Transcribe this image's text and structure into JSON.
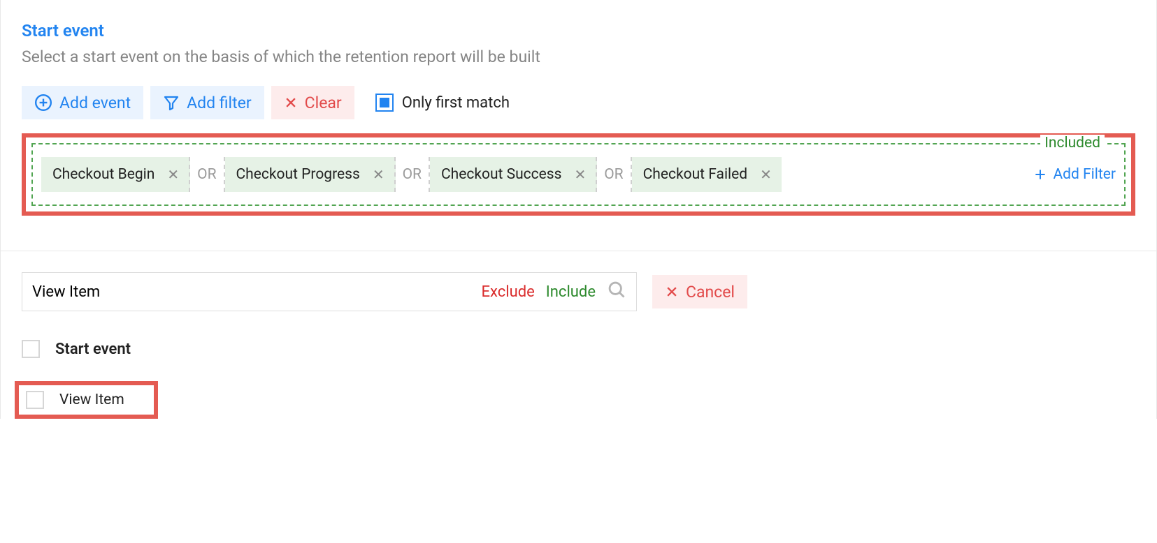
{
  "header": {
    "title": "Start event",
    "subtitle": "Select a start event on the basis of which the retention report will be built"
  },
  "toolbar": {
    "add_event": "Add event",
    "add_filter": "Add filter",
    "clear": "Clear",
    "only_first_match": "Only first match"
  },
  "included": {
    "legend": "Included",
    "chips": [
      "Checkout Begin",
      "Checkout Progress",
      "Checkout Success",
      "Checkout Failed"
    ],
    "or": "OR",
    "add_filter": "Add Filter"
  },
  "search": {
    "value": "View Item",
    "exclude": "Exclude",
    "include": "Include",
    "cancel": "Cancel"
  },
  "list": {
    "group_header": "Start event",
    "result": "View Item"
  }
}
